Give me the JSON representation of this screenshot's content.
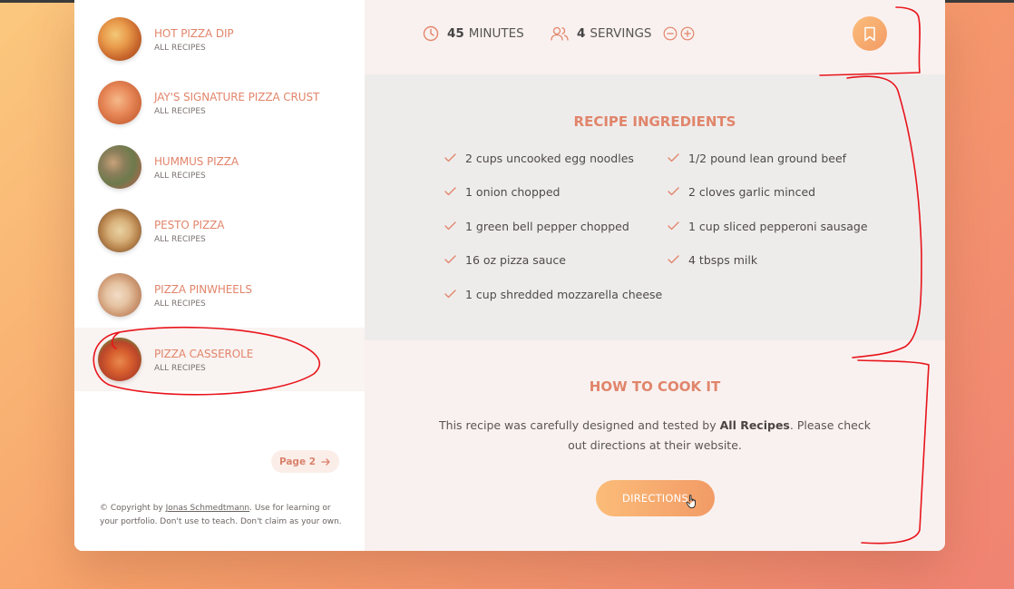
{
  "sidebar": {
    "recipes": [
      {
        "title": "HOT PIZZA DIP",
        "subtitle": "ALL RECIPES"
      },
      {
        "title": "JAY'S SIGNATURE PIZZA CRUST",
        "subtitle": "ALL RECIPES"
      },
      {
        "title": "HUMMUS PIZZA",
        "subtitle": "ALL RECIPES"
      },
      {
        "title": "PESTO PIZZA",
        "subtitle": "ALL RECIPES"
      },
      {
        "title": "PIZZA PINWHEELS",
        "subtitle": "ALL RECIPES"
      },
      {
        "title": "PIZZA CASSEROLE",
        "subtitle": "ALL RECIPES"
      }
    ],
    "active_recipe": "PIZZA CASSEROLE",
    "pagination": {
      "label": "Page 2",
      "icon": "arrow-right-icon"
    },
    "copyright": {
      "prefix": "© Copyright by ",
      "author": "Jonas Schmedtmann",
      "suffix": ". Use for learning or your portfolio. Don't use to teach. Don't claim as your own."
    }
  },
  "recipe": {
    "time_value": "45",
    "time_unit": "MINUTES",
    "servings_value": "4",
    "servings_unit": "SERVINGS",
    "ingredients_title": "RECIPE INGREDIENTS",
    "ingredients": [
      "2 cups uncooked egg noodles",
      "1/2 pound lean ground beef",
      "1 onion chopped",
      "2 cloves garlic minced",
      "1 green bell pepper chopped",
      "1 cup sliced pepperoni sausage",
      "16 oz pizza sauce",
      "4 tbsps milk",
      "1 cup shredded mozzarella cheese"
    ],
    "howto_title": "HOW TO COOK IT",
    "howto_text_before": "This recipe was carefully designed and tested by ",
    "howto_publisher": "All Recipes",
    "howto_text_after": ". Please check out directions at their website.",
    "directions_label": "DIRECTIONS"
  },
  "colors": {
    "accent": "#e2856b",
    "gradient_start": "#fbbc79",
    "gradient_end": "#f29b66",
    "annotation": "#e8141b"
  },
  "icons": [
    "clock-icon",
    "users-icon",
    "minus-circle-icon",
    "plus-circle-icon",
    "bookmark-icon",
    "check-icon",
    "arrow-right-icon",
    "hand-cursor-icon"
  ]
}
